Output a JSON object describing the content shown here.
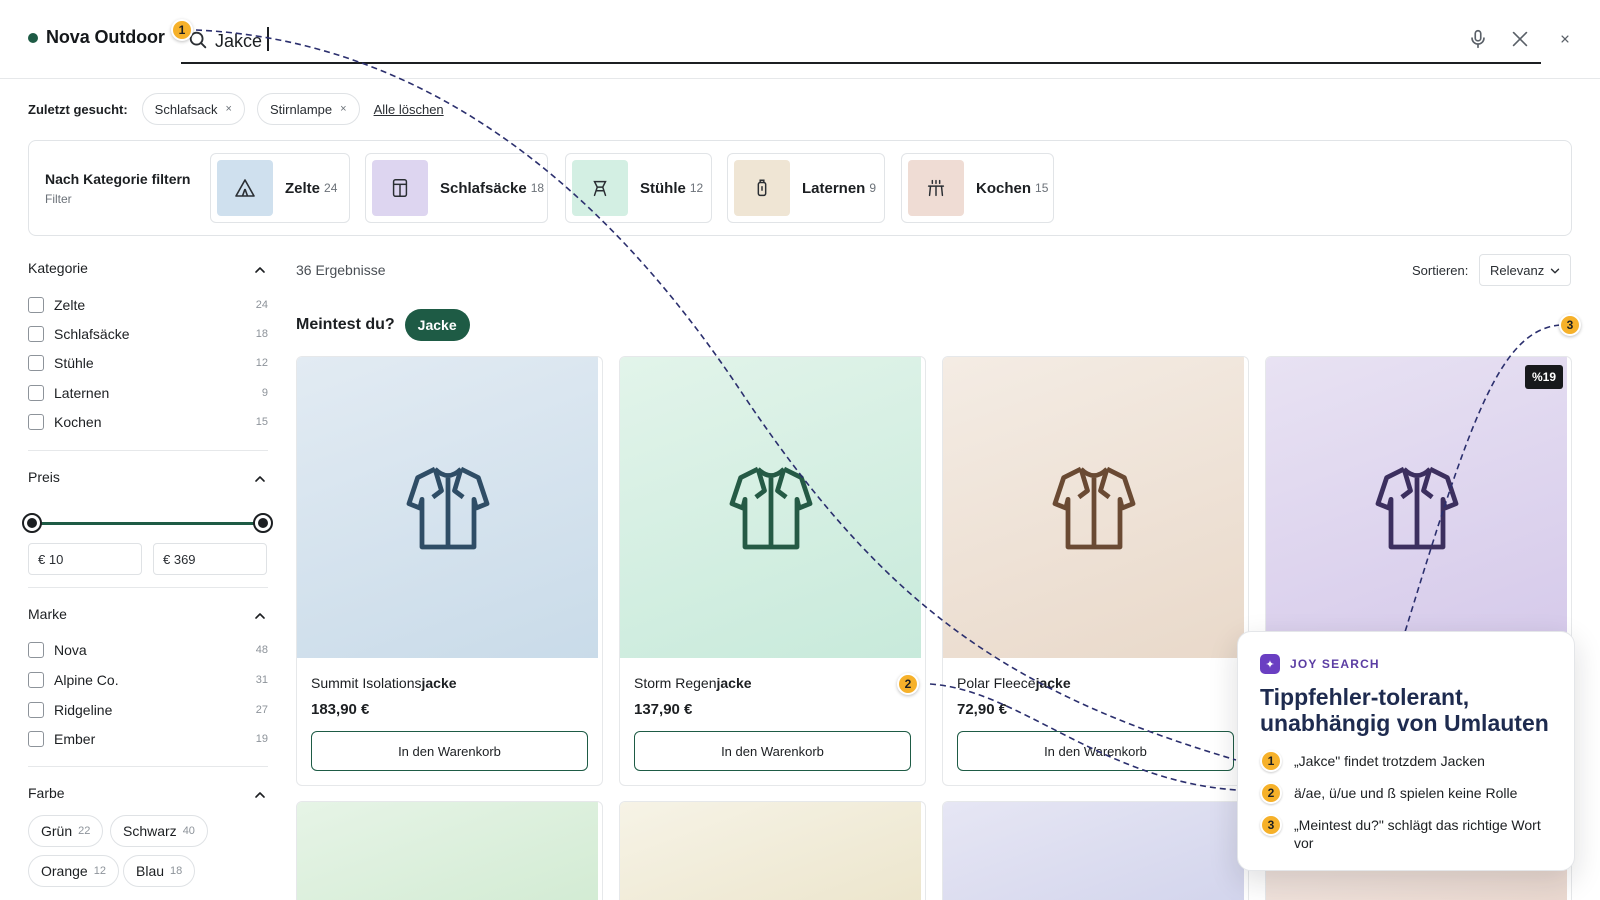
{
  "brand": {
    "name": "Nova Outdoor",
    "dot_color": "#1e5b45"
  },
  "search": {
    "value": "Jakce",
    "placeholder": ""
  },
  "recent": {
    "label": "Zuletzt gesucht:",
    "items": [
      "Schlafsack",
      "Stirnlampe"
    ],
    "remove_glyph": "×",
    "clear_label": "Alle löschen"
  },
  "category_filter": {
    "title": "Nach Kategorie filtern",
    "subtitle": "Filter",
    "tiles": [
      {
        "name": "Zelte",
        "count": "24",
        "icon": "tent-icon",
        "tint": "#cfe0ee"
      },
      {
        "name": "Schlafsäcke",
        "count": "18",
        "icon": "sleeping-bag-icon",
        "tint": "#ddd5f0"
      },
      {
        "name": "Stühle",
        "count": "12",
        "icon": "chair-icon",
        "tint": "#d3efe3"
      },
      {
        "name": "Laternen",
        "count": "9",
        "icon": "lantern-icon",
        "tint": "#efe5d4"
      },
      {
        "name": "Kochen",
        "count": "15",
        "icon": "stove-icon",
        "tint": "#efdcd4"
      }
    ]
  },
  "sidebar": {
    "kategorie": {
      "title": "Kategorie",
      "items": [
        {
          "label": "Zelte",
          "count": "24"
        },
        {
          "label": "Schlafsäcke",
          "count": "18"
        },
        {
          "label": "Stühle",
          "count": "12"
        },
        {
          "label": "Laternen",
          "count": "9"
        },
        {
          "label": "Kochen",
          "count": "15"
        }
      ]
    },
    "preis": {
      "title": "Preis",
      "min": "€ 10",
      "max": "€ 369",
      "range_fraction": [
        0.0,
        1.0
      ]
    },
    "marke": {
      "title": "Marke",
      "items": [
        {
          "label": "Nova",
          "count": "48"
        },
        {
          "label": "Alpine Co.",
          "count": "31"
        },
        {
          "label": "Ridgeline",
          "count": "27"
        },
        {
          "label": "Ember",
          "count": "19"
        }
      ]
    },
    "farbe": {
      "title": "Farbe",
      "items": [
        {
          "label": "Grün",
          "count": "22"
        },
        {
          "label": "Schwarz",
          "count": "40"
        },
        {
          "label": "Orange",
          "count": "12"
        },
        {
          "label": "Blau",
          "count": "18"
        }
      ]
    }
  },
  "results": {
    "count_text": "36 Ergebnisse",
    "sort_label": "Sortieren:",
    "sort_value": "Relevanz",
    "did_you_mean_label": "Meintest du?",
    "did_you_mean_value": "Jacke"
  },
  "products": [
    {
      "title_prefix": "Summit Isolations",
      "title_match": "jacke",
      "price": "183,90 €",
      "cta": "In den Warenkorb",
      "bg": "#d5e3ee",
      "icon_color": "#2f4d66",
      "icon": "jacket-icon"
    },
    {
      "title_prefix": "Storm Regen",
      "title_match": "jacke",
      "price": "137,90 €",
      "cta": "In den Warenkorb",
      "bg": "#d3eee1",
      "icon_color": "#255a45",
      "icon": "jacket-icon"
    },
    {
      "title_prefix": "Polar Fleece",
      "title_match": "jacke",
      "price": "72,90 €",
      "cta": "In den Warenkorb",
      "bg": "#f0e4d9",
      "icon_color": "#6a4a33",
      "icon": "jacket-icon"
    },
    {
      "title_prefix": "",
      "title_match": "",
      "price": "",
      "cta": "",
      "bg": "#e0d8ef",
      "icon_color": "#3c2f5f",
      "icon": "jacket-icon",
      "badge": "%19"
    }
  ],
  "next_row_tints": [
    "#d9eed9",
    "#f3efdc",
    "#dcdcf0",
    "#f0e2dc"
  ],
  "callout": {
    "tag": "JOY SEARCH",
    "tag_icon": "sparkle-icon",
    "title": "Tippfehler-tolerant, unabhängig von Umlauten",
    "items": [
      {
        "num": "1",
        "text": "„Jakce\" findet trotzdem Jacken"
      },
      {
        "num": "2",
        "text": "ä/ae, ü/ue und ß spielen keine Rolle"
      },
      {
        "num": "3",
        "text": "„Meintest du?\" schlägt das richtige Wort vor"
      }
    ]
  },
  "markers": [
    "1",
    "2",
    "3"
  ],
  "colors": {
    "accent": "#1e5b45",
    "marker": "#f6b12a",
    "callout_title": "#1e2b4f",
    "tag": "#5b3da3"
  }
}
